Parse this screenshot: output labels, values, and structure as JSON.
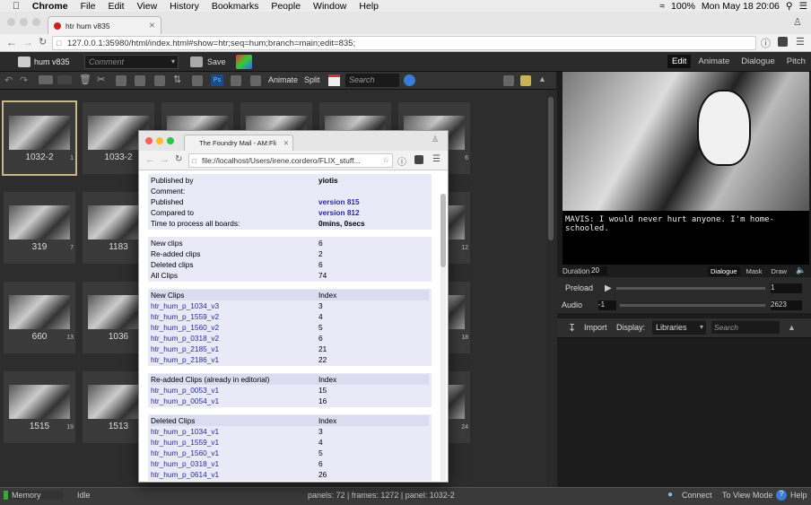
{
  "menubar": {
    "app": "Chrome",
    "items": [
      "File",
      "Edit",
      "View",
      "History",
      "Bookmarks",
      "People",
      "Window",
      "Help"
    ],
    "battery": "100%",
    "clock": "Mon May 18  20:06"
  },
  "browser": {
    "tab_title": "htr hum v835",
    "url": "127.0.0.1:35980/html/index.html#show=htr;seq=hum;branch=main;edit=835;"
  },
  "app": {
    "seq_label": "hum v835",
    "comment_placeholder": "Comment",
    "save": "Save",
    "modes": [
      "Edit",
      "Animate",
      "Dialogue",
      "Pitch"
    ],
    "tools": {
      "animate": "Animate",
      "split": "Split",
      "search_placeholder": "Search"
    },
    "thumbs": [
      {
        "label": "1032-2",
        "sub": "1"
      },
      {
        "label": "1033-2",
        "sub": ""
      },
      {
        "label": "",
        "sub": ""
      },
      {
        "label": "",
        "sub": ""
      },
      {
        "label": "",
        "sub": ""
      },
      {
        "label": "",
        "sub": "6"
      },
      {
        "label": "319",
        "sub": "7"
      },
      {
        "label": "1183",
        "sub": ""
      },
      {
        "label": "",
        "sub": ""
      },
      {
        "label": "",
        "sub": ""
      },
      {
        "label": "",
        "sub": ""
      },
      {
        "label": "",
        "sub": "12"
      },
      {
        "label": "660",
        "sub": "13"
      },
      {
        "label": "1036",
        "sub": ""
      },
      {
        "label": "",
        "sub": ""
      },
      {
        "label": "",
        "sub": ""
      },
      {
        "label": "",
        "sub": ""
      },
      {
        "label": "",
        "sub": "18"
      },
      {
        "label": "1515",
        "sub": "19"
      },
      {
        "label": "1513",
        "sub": ""
      },
      {
        "label": "",
        "sub": ""
      },
      {
        "label": "",
        "sub": ""
      },
      {
        "label": "",
        "sub": ""
      },
      {
        "label": "",
        "sub": "24"
      }
    ],
    "dialogue": "MAVIS: I would never hurt anyone.  I'm home-schooled.",
    "duration_label": "Duration",
    "duration": "20",
    "panel_tabs": [
      "Dialogue",
      "Mask",
      "Draw"
    ],
    "preload": "Preload",
    "preload_val": "1",
    "audio": "Audio",
    "audio_min": "-1",
    "audio_val": "2623",
    "import": "Import",
    "display": "Display:",
    "libraries": "Libraries",
    "lib_search": "Search",
    "status": {
      "memory": "Memory",
      "idle": "Idle",
      "info": "panels: 72 | frames: 1272 | panel: 1032-2",
      "connect": "Connect",
      "view_mode": "To View Mode",
      "help": "Help"
    }
  },
  "popup": {
    "tab_title": "The Foundry Mail - AM:Fli",
    "url": "file://localhost/Users/irene.cordero/FLIX_stuff...",
    "summary": [
      {
        "k": "Published by",
        "v": "yiotis",
        "bold": true
      },
      {
        "k": "Comment:",
        "v": ""
      },
      {
        "k": "Published",
        "v": "version 815",
        "link": true
      },
      {
        "k": "Compared to",
        "v": "version 812",
        "link": true
      },
      {
        "k": "Time to process all boards:",
        "v": "0mins, 0secs",
        "bold": true
      }
    ],
    "counts": [
      {
        "k": "New clips",
        "v": "6"
      },
      {
        "k": "Re-added clips",
        "v": "2"
      },
      {
        "k": "Deleted clips",
        "v": "6"
      },
      {
        "k": "All Clips",
        "v": "74"
      }
    ],
    "new_clips": {
      "header": "New Clips",
      "index": "Index",
      "rows": [
        {
          "k": "htr_hum_p_1034_v3",
          "v": "3"
        },
        {
          "k": "htr_hum_p_1559_v2",
          "v": "4"
        },
        {
          "k": "htr_hum_p_1560_v2",
          "v": "5"
        },
        {
          "k": "htr_hum_p_0318_v2",
          "v": "6"
        },
        {
          "k": "htr_hum_p_2185_v1",
          "v": "21"
        },
        {
          "k": "htr_hum_p_2186_v1",
          "v": "22"
        }
      ]
    },
    "readded": {
      "header": "Re-added Clips (already in editorial)",
      "index": "Index",
      "rows": [
        {
          "k": "htr_hum_p_0053_v1",
          "v": "15"
        },
        {
          "k": "htr_hum_p_0054_v1",
          "v": "16"
        }
      ]
    },
    "deleted": {
      "header": "Deleted Clips",
      "index": "Index",
      "rows": [
        {
          "k": "htr_hum_p_1034_v1",
          "v": "3"
        },
        {
          "k": "htr_hum_p_1559_v1",
          "v": "4"
        },
        {
          "k": "htr_hum_p_1560_v1",
          "v": "5"
        },
        {
          "k": "htr_hum_p_0318_v1",
          "v": "6"
        },
        {
          "k": "htr_hum_p_0614_v1",
          "v": "26"
        }
      ]
    }
  }
}
